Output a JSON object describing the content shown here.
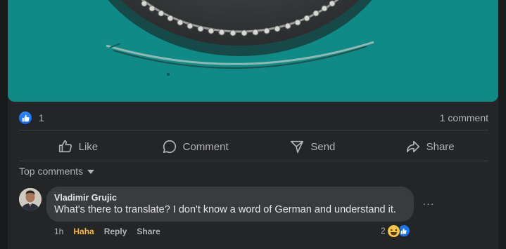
{
  "post": {
    "reaction_count": "1",
    "comment_count": "1 comment",
    "actions": {
      "like": "Like",
      "comment": "Comment",
      "send": "Send",
      "share": "Share"
    },
    "sort_label": "Top comments"
  },
  "comment": {
    "author": "Vladimir Grujic",
    "text": "What's there to translate? I don't know a word of German and understand it.",
    "time": "1h",
    "reaction_link": "Haha",
    "reply_label": "Reply",
    "share_label": "Share",
    "reaction_count": "2",
    "more_label": "···"
  },
  "colors": {
    "background": "#242526",
    "accent": "#0866ff",
    "haha": "#f7b928",
    "photo_bg": "#0f8a87"
  },
  "icons": [
    "like-icon",
    "comment-icon",
    "send-icon",
    "share-icon",
    "chevron-down-icon",
    "haha-emoji-icon"
  ]
}
